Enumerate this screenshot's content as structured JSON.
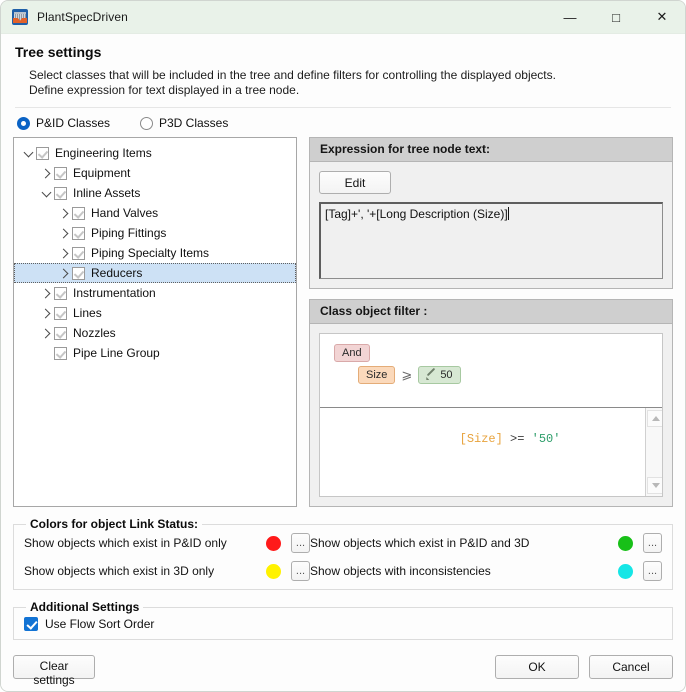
{
  "window": {
    "title": "PlantSpecDriven",
    "icon": "plant-app-icon",
    "minimize": "—",
    "maximize": "□",
    "close": "✕"
  },
  "header": {
    "title": "Tree settings",
    "description_line1": "Select classes that will be included in the tree and define filters for controlling the displayed objects.",
    "description_line2": "Define expression for text displayed in a tree node."
  },
  "class_mode": {
    "options": [
      {
        "label": "P&ID Classes",
        "selected": true
      },
      {
        "label": "P3D Classes",
        "selected": false
      }
    ]
  },
  "tree": {
    "nodes": [
      {
        "label": "Engineering Items",
        "depth": 0,
        "toggle": "expanded",
        "checked": true
      },
      {
        "label": "Equipment",
        "depth": 1,
        "toggle": "collapsed",
        "checked": true
      },
      {
        "label": "Inline Assets",
        "depth": 1,
        "toggle": "expanded",
        "checked": true
      },
      {
        "label": "Hand Valves",
        "depth": 2,
        "toggle": "collapsed",
        "checked": true
      },
      {
        "label": "Piping Fittings",
        "depth": 2,
        "toggle": "collapsed",
        "checked": true
      },
      {
        "label": "Piping Specialty Items",
        "depth": 2,
        "toggle": "collapsed",
        "checked": true
      },
      {
        "label": "Reducers",
        "depth": 2,
        "toggle": "collapsed",
        "checked": true,
        "selected": true
      },
      {
        "label": "Instrumentation",
        "depth": 1,
        "toggle": "collapsed",
        "checked": true
      },
      {
        "label": "Lines",
        "depth": 1,
        "toggle": "collapsed",
        "checked": true
      },
      {
        "label": "Nozzles",
        "depth": 1,
        "toggle": "collapsed",
        "checked": true
      },
      {
        "label": "Pipe Line Group",
        "depth": 1,
        "toggle": "none",
        "checked": true
      }
    ]
  },
  "expression_group": {
    "header": "Expression for tree node text:",
    "edit_button": "Edit",
    "expression_value": "[Tag]+', '+[Long Description (Size)]"
  },
  "filter_group": {
    "header": "Class object filter :",
    "chips": {
      "logic": "And",
      "field": "Size",
      "operator": "⩾",
      "value": "50",
      "value_icon": "pencil-icon"
    },
    "sql": {
      "field": "[Size]",
      "operator": ">=",
      "value": "'50'"
    },
    "scroll_up_icon": "scroll-up-icon",
    "scroll_down_icon": "scroll-down-icon"
  },
  "colors_group": {
    "legend": "Colors for object Link Status:",
    "rows": [
      {
        "label": "Show objects which exist in P&ID only",
        "color": "#FF1A1A",
        "button": "..."
      },
      {
        "label": "Show objects which exist in P&ID and 3D",
        "color": "#18C018",
        "button": "..."
      },
      {
        "label": "Show objects which exist in 3D only",
        "color": "#FFF200",
        "button": "..."
      },
      {
        "label": "Show objects with inconsistencies",
        "color": "#16E6E6",
        "button": "..."
      }
    ]
  },
  "additional_settings": {
    "legend": "Additional Settings",
    "flow_sort_label": "Use Flow Sort Order",
    "flow_sort_checked": true
  },
  "footer": {
    "clear": "Clear settings",
    "ok": "OK",
    "cancel": "Cancel"
  }
}
